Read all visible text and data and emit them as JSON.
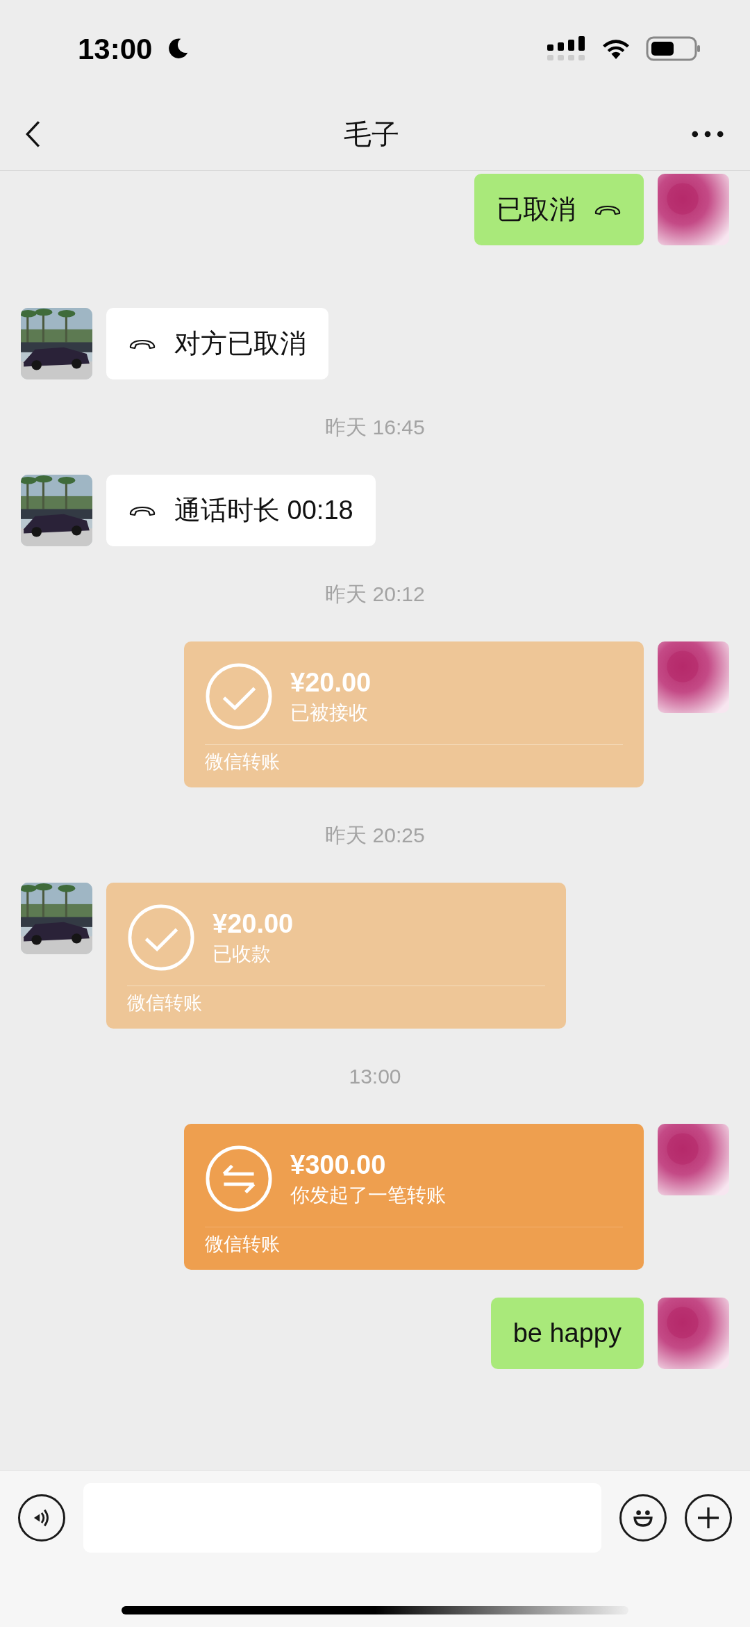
{
  "status_bar": {
    "time": "13:00"
  },
  "header": {
    "title": "毛子"
  },
  "messages": [
    {
      "kind": "call",
      "outgoing": true,
      "text": "已取消"
    },
    {
      "kind": "call",
      "outgoing": false,
      "text": "对方已取消"
    },
    {
      "kind": "timestamp",
      "text": "昨天 16:45"
    },
    {
      "kind": "call",
      "outgoing": false,
      "text": "通话时长 00:18"
    },
    {
      "kind": "timestamp",
      "text": "昨天 20:12"
    },
    {
      "kind": "transfer",
      "outgoing": true,
      "accepted": true,
      "amount": "¥20.00",
      "note": "已被接收",
      "footer": "微信转账"
    },
    {
      "kind": "timestamp",
      "text": "昨天 20:25"
    },
    {
      "kind": "transfer",
      "outgoing": false,
      "accepted": true,
      "amount": "¥20.00",
      "note": "已收款",
      "footer": "微信转账"
    },
    {
      "kind": "timestamp",
      "text": "13:00"
    },
    {
      "kind": "transfer",
      "outgoing": true,
      "accepted": false,
      "amount": "¥300.00",
      "note": "你发起了一笔转账",
      "footer": "微信转账"
    },
    {
      "kind": "text",
      "outgoing": true,
      "text": "be happy"
    }
  ]
}
